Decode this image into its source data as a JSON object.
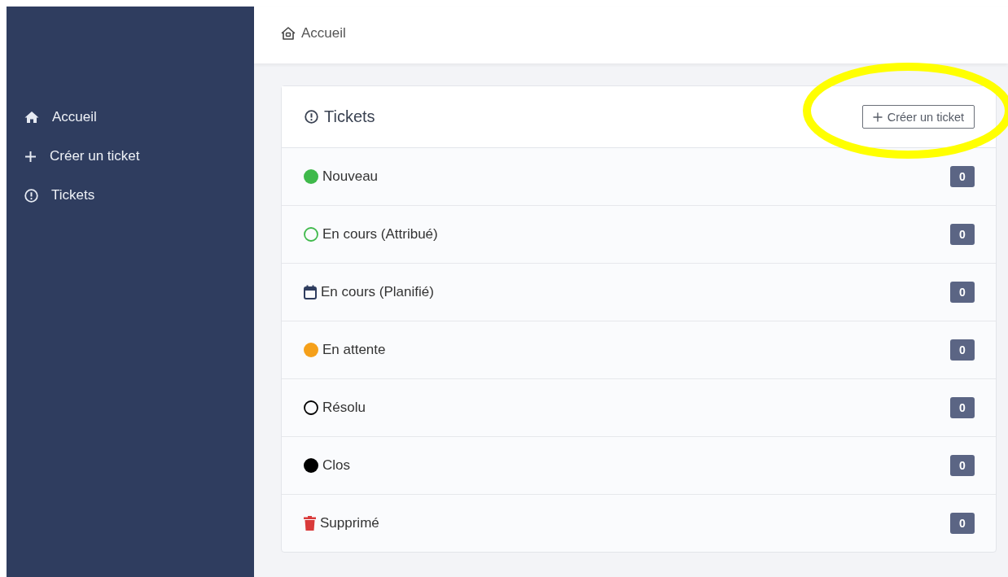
{
  "sidebar": {
    "items": [
      {
        "label": "Accueil",
        "kind": "home",
        "selected": false
      },
      {
        "label": "Créer un ticket",
        "kind": "plus",
        "selected": false
      },
      {
        "label": "Tickets",
        "kind": "alert",
        "selected": false
      }
    ]
  },
  "breadcrumb": {
    "label": "Accueil"
  },
  "card": {
    "title": "Tickets",
    "button": "Créer un ticket",
    "statuses": [
      {
        "label": "Nouveau",
        "kind": "dot",
        "color": "#3fb94b",
        "count": "0"
      },
      {
        "label": "En cours (Attribué)",
        "kind": "ring",
        "color": "#3fb94b",
        "count": "0"
      },
      {
        "label": "En cours (Planifié)",
        "kind": "calendar",
        "color": "#2f3d5f",
        "count": "0"
      },
      {
        "label": "En attente",
        "kind": "dot",
        "color": "#f5a01a",
        "count": "0"
      },
      {
        "label": "Résolu",
        "kind": "ring",
        "color": "#000000",
        "count": "0"
      },
      {
        "label": "Clos",
        "kind": "dot",
        "color": "#000000",
        "count": "0"
      },
      {
        "label": "Supprimé",
        "kind": "trash",
        "color": "#d93a3a",
        "count": "0"
      }
    ]
  }
}
